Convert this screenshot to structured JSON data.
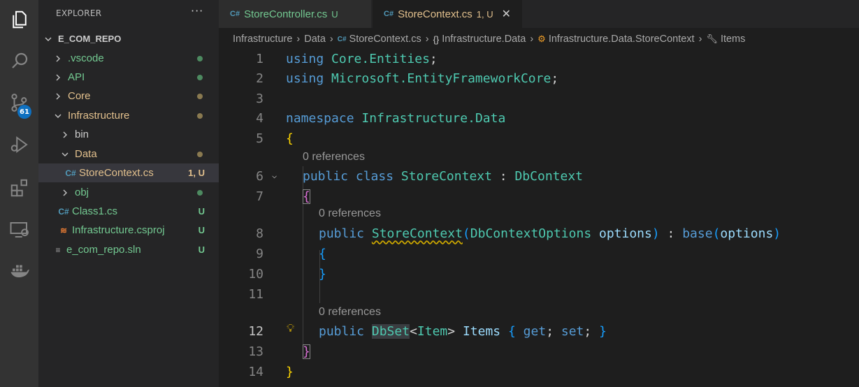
{
  "activity": {
    "badge": "61",
    "icons": [
      "explorer-icon",
      "search-icon",
      "source-control-icon",
      "run-debug-icon",
      "extensions-icon",
      "remote-explorer-icon",
      "docker-icon"
    ]
  },
  "sidebar": {
    "title": "EXPLORER",
    "more": "···",
    "root": "E_COM_REPO",
    "items": [
      {
        "label": ".vscode",
        "status": ""
      },
      {
        "label": "API",
        "status": ""
      },
      {
        "label": "Core",
        "status": ""
      },
      {
        "label": "Infrastructure",
        "status": ""
      },
      {
        "label": "bin",
        "status": ""
      },
      {
        "label": "Data",
        "status": ""
      },
      {
        "label": "StoreContext.cs",
        "status": "1, U"
      },
      {
        "label": "obj",
        "status": ""
      },
      {
        "label": "Class1.cs",
        "status": "U"
      },
      {
        "label": "Infrastructure.csproj",
        "status": "U"
      },
      {
        "label": "e_com_repo.sln",
        "status": "U"
      }
    ]
  },
  "tabs": [
    {
      "label": "StoreController.cs",
      "mod": "U"
    },
    {
      "label": "StoreContext.cs",
      "mod": "1, U",
      "close": "✕"
    }
  ],
  "breadcrumb": {
    "b1": "Infrastructure",
    "b2": "Data",
    "b3": "StoreContext.cs",
    "b4": "Infrastructure.Data",
    "b5": "Infrastructure.Data.StoreContext",
    "b6": "Items"
  },
  "editor": {
    "line_numbers": [
      "1",
      "2",
      "3",
      "4",
      "5",
      "6",
      "7",
      "8",
      "9",
      "10",
      "11",
      "12",
      "13",
      "14"
    ],
    "codelens": "0 references",
    "lines": {
      "l1": {
        "kw": "using",
        "ns": "Core.Entities",
        "p": ";"
      },
      "l2": {
        "kw": "using",
        "ns": "Microsoft.EntityFrameworkCore",
        "p": ";"
      },
      "l4": {
        "kw": "namespace",
        "ns": "Infrastructure.Data"
      },
      "l5": {
        "b": "{"
      },
      "l6": {
        "kw1": "public",
        "kw2": "class",
        "name": "StoreContext",
        "colon": " : ",
        "base": "DbContext"
      },
      "l7": {
        "b": "{"
      },
      "l8": {
        "kw": "public",
        "name": "StoreContext",
        "open": "(",
        "ptype": "DbContextOptions",
        "pname": "options",
        "close": ")",
        "colon": " : ",
        "base": "base",
        "open2": "(",
        "arg": "options",
        "close2": ")"
      },
      "l9": {
        "b": "{"
      },
      "l10": {
        "b": "}"
      },
      "l12": {
        "kw": "public",
        "type": "DbSet",
        "lt": "<",
        "gen": "Item",
        "gt": ">",
        "name": "Items",
        "ob": "{",
        "get": "get",
        "semi1": ";",
        "set": "set",
        "semi2": ";",
        "cb": "}"
      },
      "l13": {
        "b": "}"
      },
      "l14": {
        "b": "}"
      }
    }
  },
  "colors": {
    "accent": "#0e70c0",
    "untracked": "#73c991",
    "modified": "#e2c08d",
    "keyword": "#569cd6",
    "type": "#4ec9b0",
    "variable": "#9cdcfe"
  }
}
